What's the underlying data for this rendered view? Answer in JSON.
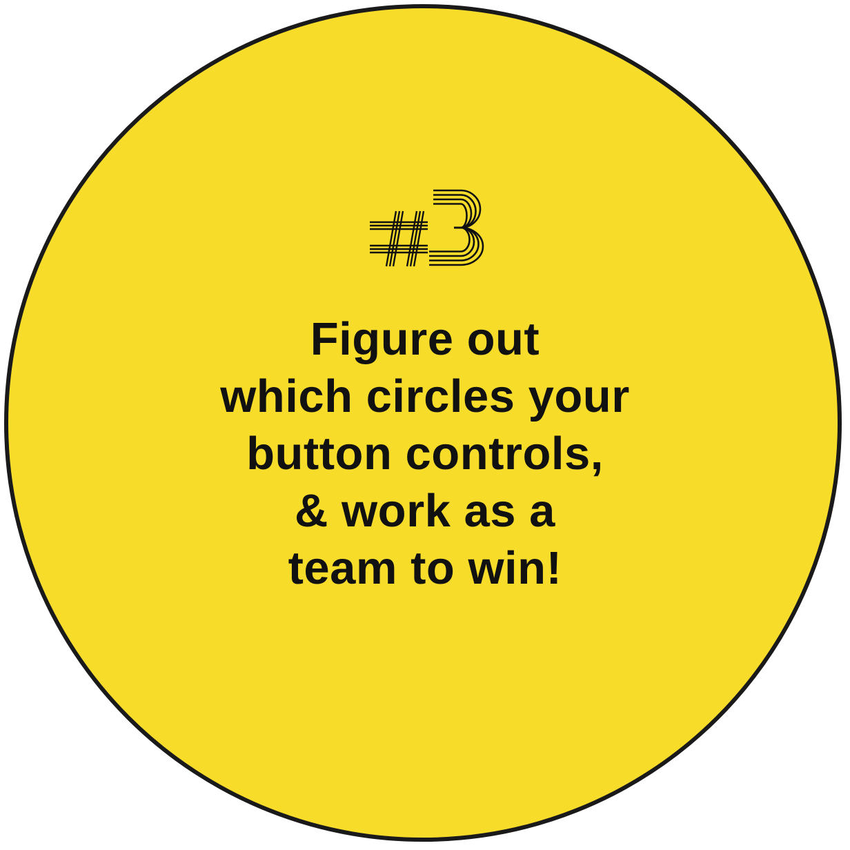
{
  "card": {
    "fill_color": "#F8DC2A",
    "border_color": "#1A1A1A",
    "text_color": "#111111"
  },
  "badge": {
    "icon": "hash-three-icon",
    "text": "#3"
  },
  "message": {
    "lines": [
      "Figure out",
      "which circles your",
      "button controls,",
      "& work as a",
      "team to win!"
    ]
  }
}
